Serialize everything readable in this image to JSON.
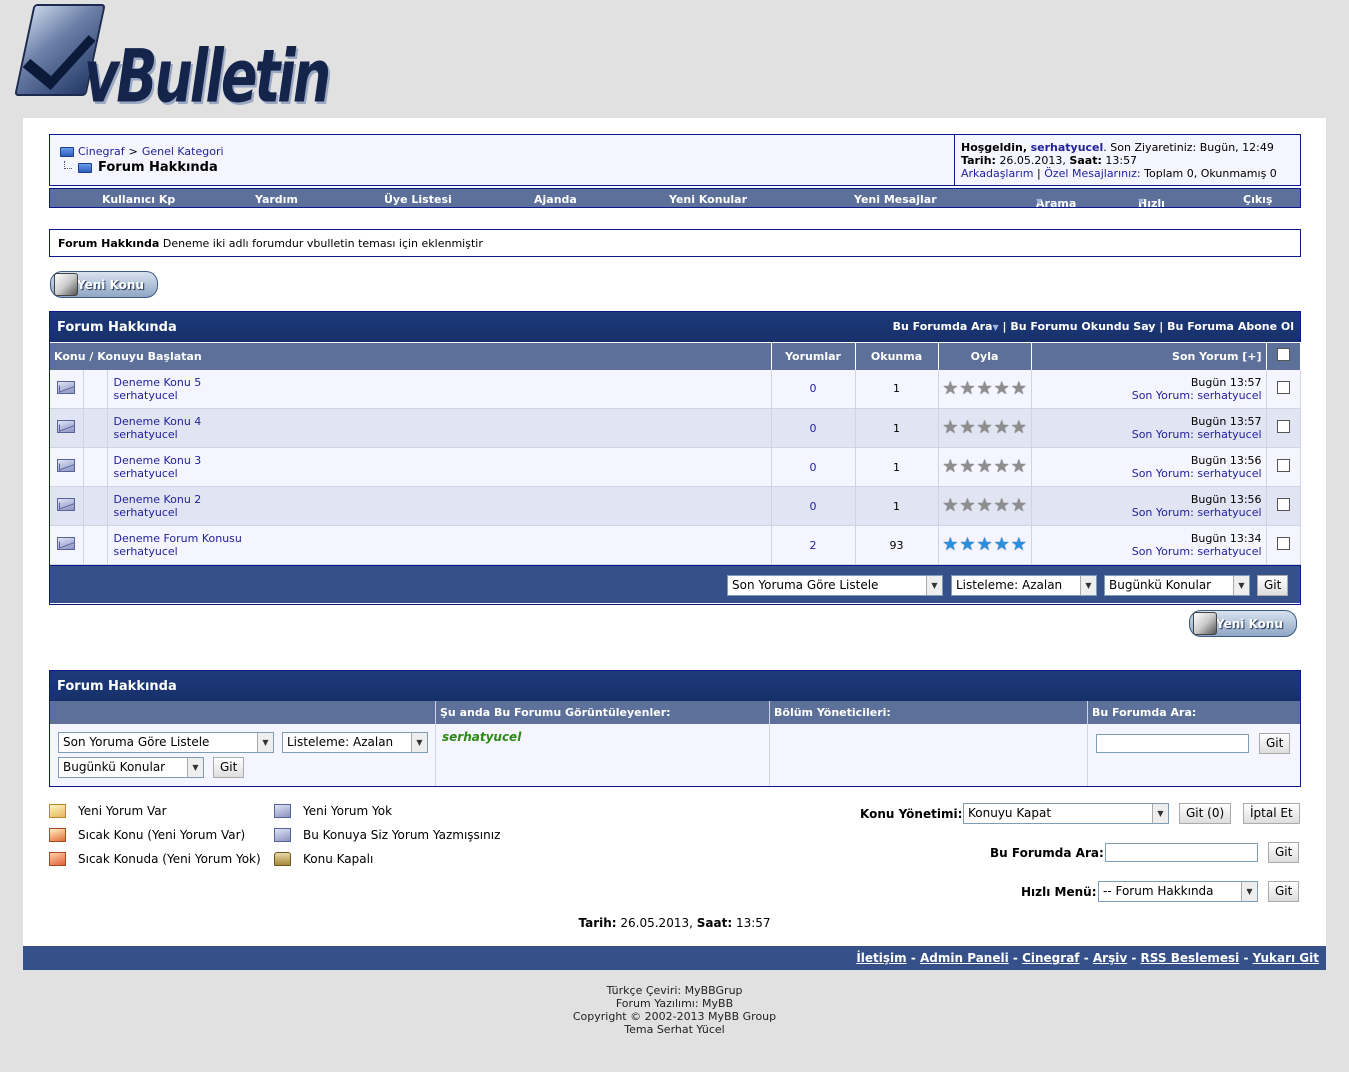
{
  "logo": {
    "text": "vBulletin"
  },
  "breadcrumb": {
    "root": "Cinegraf",
    "separator": ">",
    "category": "Genel Kategori",
    "current": "Forum Hakkında"
  },
  "user_panel": {
    "welcome_label": "Hoşgeldin,",
    "username": "serhatyucel",
    "last_visit": "Son Ziyaretiniz: Bugün, 12:49",
    "date_label": "Tarih:",
    "date_value": "26.05.2013,",
    "time_label": "Saat:",
    "time_value": "13:57",
    "friends_link": "Arkadaşlarım",
    "pm_link": "Özel Mesajlarınız:",
    "pm_counts": "Toplam 0, Okunmamış 0"
  },
  "menu": {
    "items": [
      "Kullanıcı Kp",
      "Yardım",
      "Üye Listesi",
      "Ajanda",
      "Yeni Konular",
      "Yeni Mesajlar",
      "Arama",
      "Hızlı Panel",
      "Çıkış"
    ]
  },
  "description": {
    "title": "Forum Hakkında",
    "text": "Deneme iki adlı forumdur vbulletin teması için eklenmiştir"
  },
  "new_thread_label": "Yeni Konu",
  "thread_list": {
    "title": "Forum Hakkında",
    "search_action": "Bu Forumda Ara",
    "mark_read_action": "Bu Forumu Okundu Say",
    "subscribe_action": "Bu Foruma Abone Ol",
    "action_sep": "|",
    "columns": {
      "thread": "Konu / Konuyu Başlatan",
      "replies": "Yorumlar",
      "views": "Okunma",
      "rating": "Oyla",
      "last_post": "Son Yorum [+]"
    },
    "threads": [
      {
        "title": "Deneme Konu 5",
        "author": "serhatyucel",
        "replies": "0",
        "views": "1",
        "last_time": "Bugün 13:57",
        "last_by_label": "Son Yorum:",
        "last_by": "serhatyucel"
      },
      {
        "title": "Deneme Konu 4",
        "author": "serhatyucel",
        "replies": "0",
        "views": "1",
        "last_time": "Bugün 13:57",
        "last_by_label": "Son Yorum:",
        "last_by": "serhatyucel"
      },
      {
        "title": "Deneme Konu 3",
        "author": "serhatyucel",
        "replies": "0",
        "views": "1",
        "last_time": "Bugün 13:56",
        "last_by_label": "Son Yorum:",
        "last_by": "serhatyucel"
      },
      {
        "title": "Deneme Konu 2",
        "author": "serhatyucel",
        "replies": "0",
        "views": "1",
        "last_time": "Bugün 13:56",
        "last_by_label": "Son Yorum:",
        "last_by": "serhatyucel"
      },
      {
        "title": "Deneme Forum Konusu",
        "author": "serhatyucel",
        "replies": "2",
        "views": "93",
        "last_time": "Bugün 13:34",
        "last_by_label": "Son Yorum:",
        "last_by": "serhatyucel"
      }
    ],
    "ratings_filled": [
      0,
      0,
      0,
      0,
      5
    ],
    "ratings_max": 5,
    "sort_select": "Son Yoruma Göre Listele",
    "order_select": "Listeleme: Azalan",
    "range_select": "Bugünkü Konular",
    "go_label": "Git"
  },
  "info_box": {
    "title": "Forum Hakkında",
    "viewers_header": "Şu anda Bu Forumu Görüntüleyenler:",
    "moderators_header": "Bölüm Yöneticileri:",
    "search_header": "Bu Forumda Ara:",
    "viewer_name": "serhatyucel",
    "sort_select": "Son Yoruma Göre Listele",
    "order_select": "Listeleme: Azalan",
    "range_select": "Bugünkü Konular",
    "go_label": "Git"
  },
  "legend": {
    "new_posts": "Yeni Yorum Var",
    "hot_new": "Sıcak Konu (Yeni Yorum Var)",
    "hot_no_new": "Sıcak Konuda (Yeni Yorum Yok)",
    "no_new": "Yeni Yorum Yok",
    "you_posted": "Bu Konuya Siz Yorum Yazmışsınız",
    "closed": "Konu Kapalı"
  },
  "moderation": {
    "label": "Konu Yönetimi:",
    "select": "Konuyu Kapat",
    "go_label": "Git (0)",
    "cancel_label": "İptal Et",
    "search_label": "Bu Forumda Ara:",
    "search_go": "Git",
    "quick_label": "Hızlı Menü:",
    "quick_select": "-- Forum Hakkında",
    "quick_go": "Git"
  },
  "date_footer": {
    "date_label": "Tarih:",
    "date_value": "26.05.2013,",
    "time_label": "Saat:",
    "time_value": "13:57"
  },
  "footer_links": [
    "İletişim",
    "Admin Paneli",
    "Cinegraf",
    "Arşiv",
    "RSS Beslemesi",
    "Yukarı Git"
  ],
  "footer_link_sep": "-",
  "credits": [
    "Türkçe Çeviri: MyBBGrup",
    "Forum Yazılımı: MyBB",
    "Copyright © 2002-2013 MyBB Group",
    "Tema Serhat Yücel"
  ]
}
